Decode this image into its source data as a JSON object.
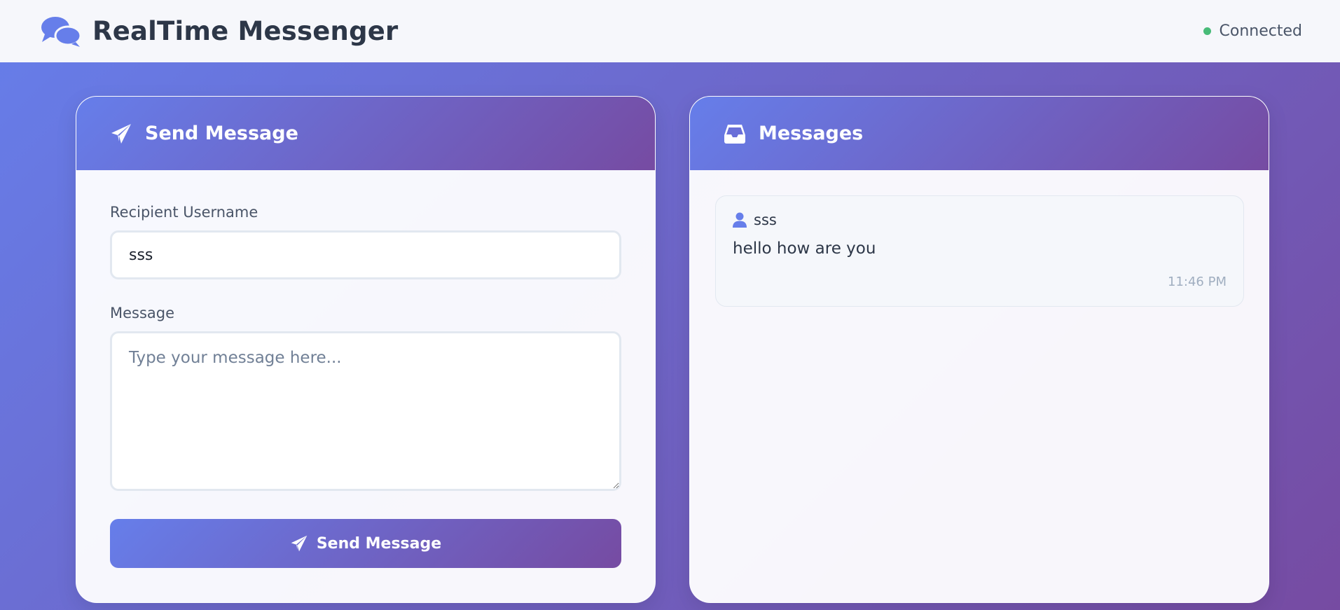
{
  "app": {
    "title": "RealTime Messenger",
    "brand_icon": "comments-icon",
    "status": "Connected",
    "status_color": "#48bb78"
  },
  "colors": {
    "gradient_start": "#667eea",
    "gradient_end": "#764ba2"
  },
  "send_panel": {
    "title": "Send Message",
    "title_icon": "paper-plane-icon",
    "recipient_label": "Recipient Username",
    "recipient_value": "sss",
    "message_label": "Message",
    "message_placeholder": "Type your message here...",
    "message_value": "",
    "send_button_label": "Send Message",
    "send_button_icon": "paper-plane-icon"
  },
  "messages_panel": {
    "title": "Messages",
    "title_icon": "inbox-icon",
    "messages": [
      {
        "sender": "sss",
        "sender_icon": "user-icon",
        "text": "hello how are you",
        "time": "11:46 PM"
      }
    ]
  }
}
